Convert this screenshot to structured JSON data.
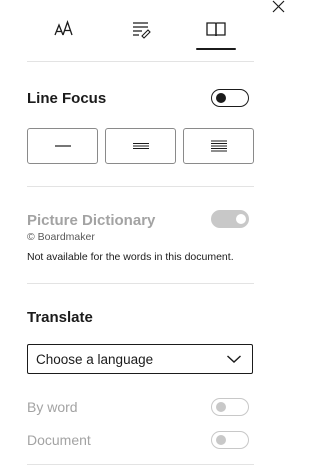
{
  "tabs": [
    {
      "icon": "text-size-icon",
      "glyph": "AA",
      "selected": false
    },
    {
      "icon": "text-options-icon",
      "selected": false
    },
    {
      "icon": "book-icon",
      "selected": true
    }
  ],
  "line_focus": {
    "title": "Line Focus",
    "toggle_state": "off",
    "options": [
      {
        "lines": 1,
        "icon": "one-line-icon"
      },
      {
        "lines": 3,
        "icon": "three-lines-icon"
      },
      {
        "lines": 5,
        "icon": "five-lines-icon"
      }
    ]
  },
  "picture_dictionary": {
    "title": "Picture Dictionary",
    "credit": "© Boardmaker",
    "note": "Not available for the words in this document.",
    "toggle_state": "on-disabled"
  },
  "translate": {
    "title": "Translate",
    "select_placeholder": "Choose a language",
    "by_word_label": "By word",
    "document_label": "Document",
    "by_word_toggle": "off-disabled",
    "document_toggle": "off-disabled"
  },
  "colors": {
    "text": "#1b1b1b",
    "disabled_text": "#a3a3a3",
    "divider": "#e3e3e3"
  }
}
